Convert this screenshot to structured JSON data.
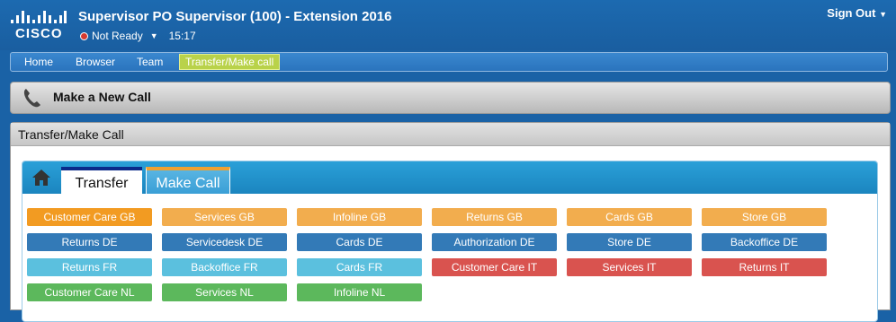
{
  "header": {
    "title": "Supervisor PO Supervisor (100) - Extension 2016",
    "status": "Not Ready",
    "time": "15:17",
    "sign_out": "Sign Out",
    "logo_text": "cisco"
  },
  "nav": {
    "items": [
      "Home",
      "Browser",
      "Team",
      "Transfer/Make call"
    ]
  },
  "panel_make_call": {
    "title": "Make a New Call"
  },
  "panel_transfer": {
    "title": "Transfer/Make Call"
  },
  "tabs": [
    "Transfer",
    "Make Call"
  ],
  "colors": {
    "dark_orange": "#f29b22",
    "light_orange": "#f2ad4e",
    "blue": "#337ab7",
    "light_blue": "#5bc0de",
    "red": "#d9534f",
    "green": "#5cb85c"
  },
  "buttons": [
    [
      {
        "label": "Customer Care GB",
        "color": "dark_orange"
      },
      {
        "label": "Services GB",
        "color": "light_orange"
      },
      {
        "label": "Infoline GB",
        "color": "light_orange"
      },
      {
        "label": "Returns GB",
        "color": "light_orange"
      },
      {
        "label": "Cards GB",
        "color": "light_orange"
      },
      {
        "label": "Store GB",
        "color": "light_orange"
      }
    ],
    [
      {
        "label": "Returns DE",
        "color": "blue"
      },
      {
        "label": "Servicedesk DE",
        "color": "blue"
      },
      {
        "label": "Cards DE",
        "color": "blue"
      },
      {
        "label": "Authorization DE",
        "color": "blue"
      },
      {
        "label": "Store DE",
        "color": "blue"
      },
      {
        "label": "Backoffice DE",
        "color": "blue"
      }
    ],
    [
      {
        "label": "Returns FR",
        "color": "light_blue"
      },
      {
        "label": "Backoffice FR",
        "color": "light_blue"
      },
      {
        "label": "Cards FR",
        "color": "light_blue"
      },
      {
        "label": "Customer Care IT",
        "color": "red"
      },
      {
        "label": "Services IT",
        "color": "red"
      },
      {
        "label": "Returns IT",
        "color": "red"
      }
    ],
    [
      {
        "label": "Customer Care NL",
        "color": "green"
      },
      {
        "label": "Services NL",
        "color": "green"
      },
      {
        "label": "Infoline NL",
        "color": "green"
      }
    ]
  ]
}
